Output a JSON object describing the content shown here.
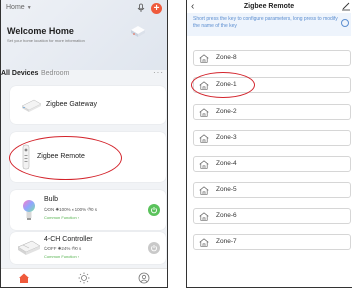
{
  "left": {
    "home_selector": "Home",
    "welcome_title": "Welcome Home",
    "welcome_subtitle": "Set your home location for more information",
    "tabs": [
      "All Devices",
      "Bedroom"
    ],
    "more": "···",
    "devices": [
      {
        "name": "Zigbee Gateway"
      },
      {
        "name": "Zigbee Remote"
      },
      {
        "name": "Bulb",
        "status": "⏻ON  ☀100%  ◐100%  ◷0 s",
        "link": "Common Function ›",
        "state": "on"
      },
      {
        "name": "4-CH Controller",
        "status": "⏻OFF  ☀24%  ◷0 s",
        "link": "Common Function ›",
        "state": "off"
      }
    ]
  },
  "right": {
    "title": "Zigbee Remote",
    "info": "Short press the key to configure parameters, long press to modify the name of the key",
    "zones": [
      "Zone-8",
      "Zone-1",
      "Zone-2",
      "Zone-3",
      "Zone-4",
      "Zone-5",
      "Zone-6",
      "Zone-7"
    ]
  },
  "colors": {
    "accent": "#ef5a3c",
    "annotation": "#d3232b",
    "on": "#5ac25b",
    "link": "#54b24e",
    "info": "#5c8ed0"
  }
}
